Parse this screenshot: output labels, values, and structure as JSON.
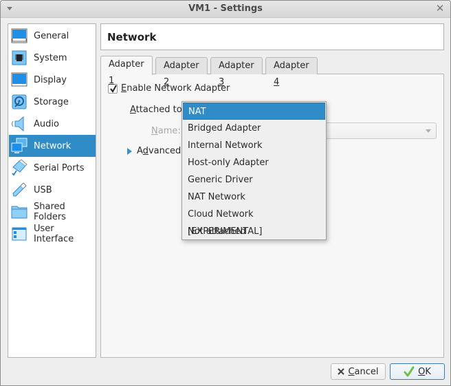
{
  "window": {
    "title": "VM1 - Settings"
  },
  "sidebar": {
    "items": [
      {
        "label": "General",
        "icon": "general-icon"
      },
      {
        "label": "System",
        "icon": "system-chip-icon"
      },
      {
        "label": "Display",
        "icon": "display-monitor-icon"
      },
      {
        "label": "Storage",
        "icon": "storage-disk-icon"
      },
      {
        "label": "Audio",
        "icon": "audio-speaker-icon"
      },
      {
        "label": "Network",
        "icon": "network-icon",
        "active": true
      },
      {
        "label": "Serial Ports",
        "icon": "serial-port-icon"
      },
      {
        "label": "USB",
        "icon": "usb-icon"
      },
      {
        "label": "Shared Folders",
        "icon": "folder-icon"
      },
      {
        "label": "User Interface",
        "icon": "user-interface-icon"
      }
    ]
  },
  "page": {
    "title": "Network"
  },
  "tabs": [
    {
      "prefix": "Adapter ",
      "mnemonic": "1",
      "active": true
    },
    {
      "prefix": "Adapter ",
      "mnemonic": "2"
    },
    {
      "prefix": "Adapter ",
      "mnemonic": "3"
    },
    {
      "prefix": "Adapter ",
      "mnemonic": "4"
    }
  ],
  "adapter": {
    "enable_mnemonic": "E",
    "enable_rest": "nable Network Adapter",
    "enabled": true,
    "attached_mnemonic": "A",
    "attached_rest": "ttached to:",
    "name_mnemonic": "N",
    "name_rest": "ame:",
    "name_value": "",
    "advanced_pre": "A",
    "advanced_mnemonic": "d",
    "advanced_rest": "vanced"
  },
  "attached_dropdown": {
    "selected": "NAT",
    "options": [
      "NAT",
      "Bridged Adapter",
      "Internal Network",
      "Host-only Adapter",
      "Generic Driver",
      "NAT Network",
      "Cloud Network [EXPERIMENTAL]",
      "Not attached"
    ]
  },
  "buttons": {
    "cancel_mnemonic": "C",
    "cancel_rest": "ancel",
    "ok_mnemonic": "O",
    "ok_rest": "K"
  },
  "colors": {
    "accent": "#308cc6",
    "window_bg": "#eeeeee"
  }
}
